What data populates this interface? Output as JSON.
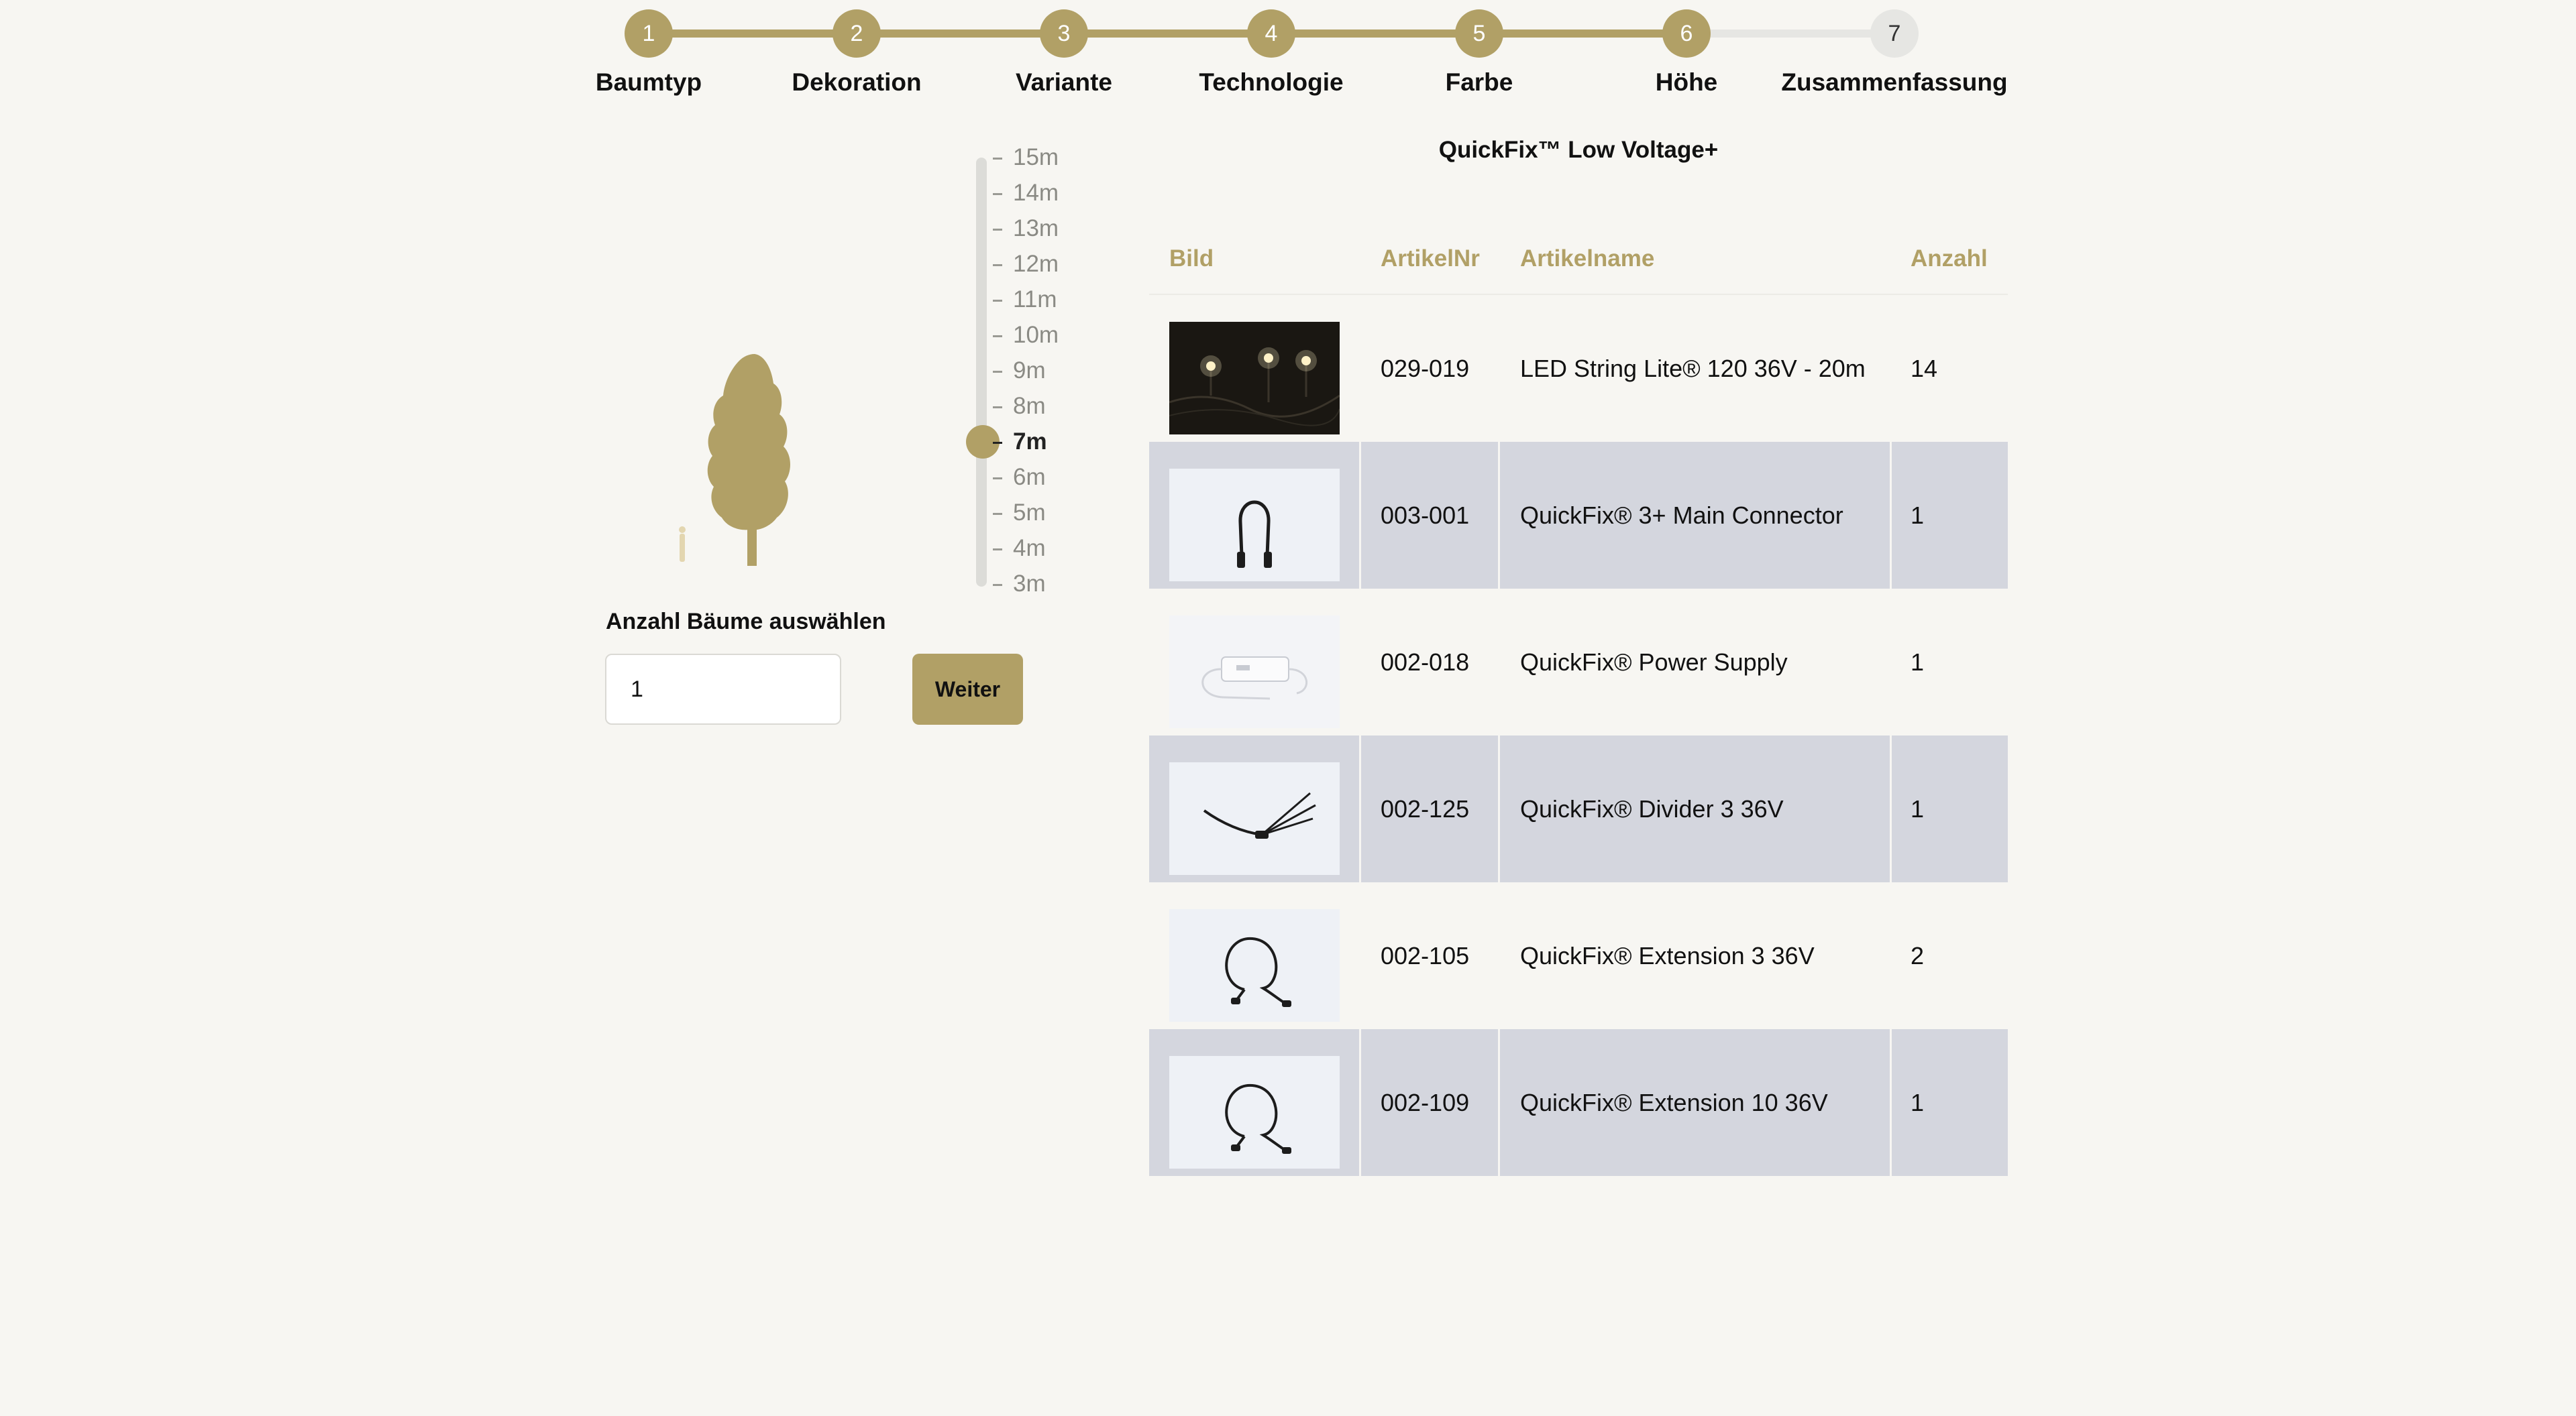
{
  "stepper": {
    "steps": [
      {
        "num": "1",
        "label": "Baumtyp"
      },
      {
        "num": "2",
        "label": "Dekoration"
      },
      {
        "num": "3",
        "label": "Variante"
      },
      {
        "num": "4",
        "label": "Technologie"
      },
      {
        "num": "5",
        "label": "Farbe"
      },
      {
        "num": "6",
        "label": "Höhe"
      },
      {
        "num": "7",
        "label": "Zusammenfassung"
      }
    ],
    "completed": 6,
    "current": 7
  },
  "height": {
    "options": [
      "15m",
      "14m",
      "13m",
      "12m",
      "11m",
      "10m",
      "9m",
      "8m",
      "7m",
      "6m",
      "5m",
      "4m",
      "3m"
    ],
    "selected": "7m"
  },
  "count": {
    "label": "Anzahl Bäume auswählen",
    "value": "1",
    "button": "Weiter"
  },
  "product": {
    "title": "QuickFix™ Low Voltage+",
    "columns": {
      "image": "Bild",
      "article_no": "ArtikelNr",
      "article_name": "Artikelname",
      "quantity": "Anzahl"
    },
    "rows": [
      {
        "article_no": "029-019",
        "name": "LED String Lite® 120 36V - 20m",
        "qty": "14",
        "image": "led-string-lights-image"
      },
      {
        "article_no": "003-001",
        "name": "QuickFix® 3+ Main Connector",
        "qty": "1",
        "image": "main-connector-image"
      },
      {
        "article_no": "002-018",
        "name": "QuickFix® Power Supply",
        "qty": "1",
        "image": "power-supply-image"
      },
      {
        "article_no": "002-125",
        "name": "QuickFix® Divider 3 36V",
        "qty": "1",
        "image": "divider-cable-image"
      },
      {
        "article_no": "002-105",
        "name": "QuickFix® Extension 3 36V",
        "qty": "2",
        "image": "extension-cable-image"
      },
      {
        "article_no": "002-109",
        "name": "QuickFix® Extension 10 36V",
        "qty": "1",
        "image": "extension-cable-image"
      }
    ]
  },
  "colors": {
    "accent": "#b1a066",
    "background": "#f7f6f2",
    "row_alt": "#d4d6de"
  }
}
